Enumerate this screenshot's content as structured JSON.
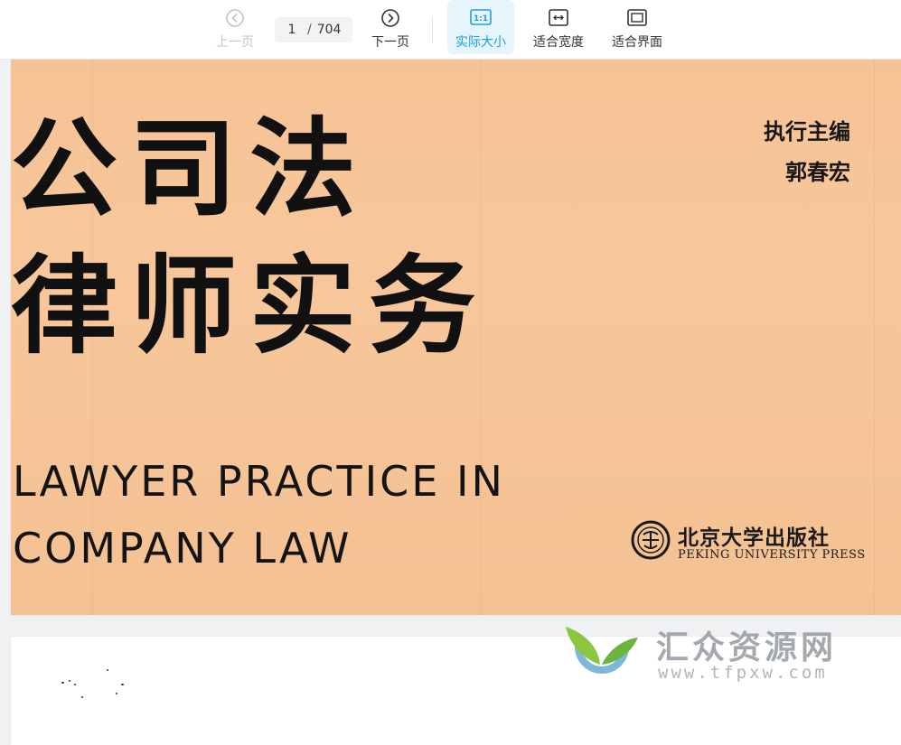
{
  "toolbar": {
    "prev": {
      "label": "上一页",
      "icon": "chevron-left-circle-icon",
      "enabled": false
    },
    "page_current": "1",
    "page_separator": "/",
    "page_total": "704",
    "next": {
      "label": "下一页",
      "icon": "chevron-right-circle-icon",
      "enabled": true
    },
    "actual_size": {
      "label": "实际大小",
      "icon_text": "1:1",
      "active": true
    },
    "fit_width": {
      "label": "适合宽度",
      "icon": "fit-width-icon"
    },
    "fit_page": {
      "label": "适合界面",
      "icon": "fit-page-icon"
    }
  },
  "cover": {
    "title_cn_line1": "公司法",
    "title_cn_line2": "律师实务",
    "title_en_line1": "LAWYER PRACTICE IN",
    "title_en_line2": "COMPANY LAW",
    "editor_role": "执行主编",
    "editor_name": "郭春宏",
    "publisher_cn": "北京大学出版社",
    "publisher_en": "PEKING UNIVERSITY PRESS",
    "background_color": "#f6c496"
  },
  "watermark": {
    "name_cn": "汇众资源网",
    "url": "www.tfpxw.com"
  },
  "colors": {
    "accent": "#1aa0e0",
    "active_bg": "#e6f4fc"
  }
}
